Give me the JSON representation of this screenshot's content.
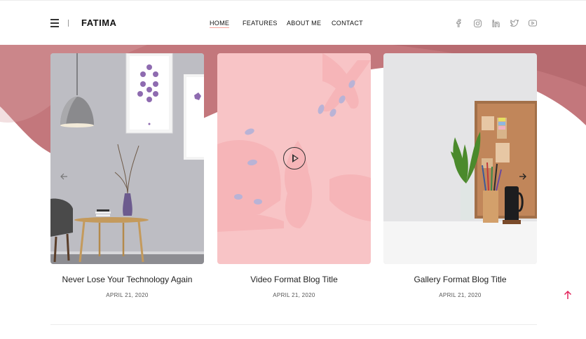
{
  "header": {
    "logo": "FATIMA",
    "nav": [
      {
        "label": "HOME",
        "active": true
      },
      {
        "label": "FEATURES",
        "active": false
      },
      {
        "label": "ABOUT ME",
        "active": false
      },
      {
        "label": "CONTACT",
        "active": false
      }
    ],
    "social": [
      "facebook-icon",
      "instagram-icon",
      "linkedin-icon",
      "twitter-icon",
      "youtube-icon"
    ]
  },
  "slider": {
    "posts": [
      {
        "title": "Never Lose Your Technology Again",
        "date": "APRIL 21, 2020",
        "format": "standard"
      },
      {
        "title": "Video Format Blog Title",
        "date": "APRIL 21, 2020",
        "format": "video"
      },
      {
        "title": "Gallery Format Blog Title",
        "date": "APRIL 21, 2020",
        "format": "gallery"
      }
    ]
  },
  "colors": {
    "band": "#c3777c",
    "video_overlay": "#f8c4c6",
    "accent": "#e2245b"
  }
}
